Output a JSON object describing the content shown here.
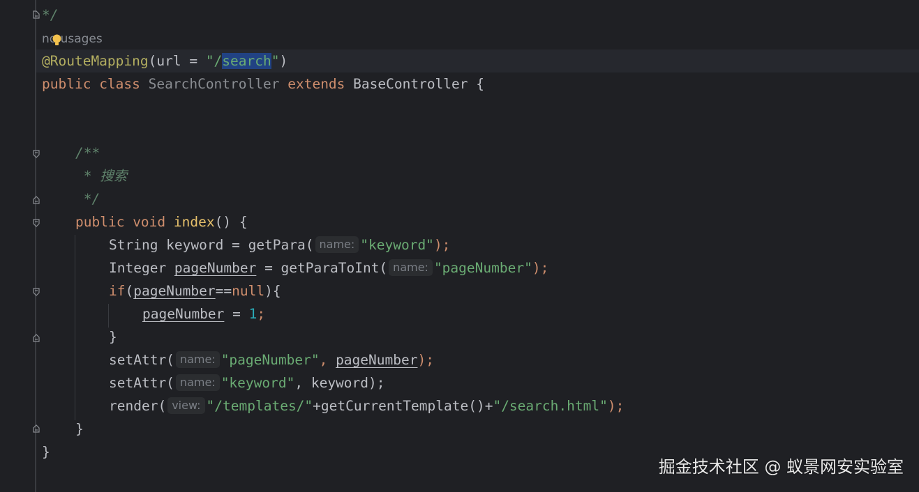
{
  "editor": {
    "usages_label": "no usages",
    "lines": {
      "l1": "*/",
      "l2_ann": "@RouteMapping",
      "l2_a": "(url = ",
      "l2_q1": "\"/",
      "l2_sel": "search",
      "l2_q2": "\"",
      "l2_b": ")",
      "l3_kw1": "public ",
      "l3_kw2": "class ",
      "l3_name": "SearchController ",
      "l3_kw3": "extends ",
      "l3_base": "BaseController {",
      "l4": "/**",
      "l5": " * 搜索",
      "l6": " */",
      "l7_kw1": "public ",
      "l7_kw2": "void ",
      "l7_fn": "index",
      "l7_rest": "() {",
      "l8_a": "String keyword = getPara(",
      "l8_hint": "name:",
      "l8_str": "\"keyword\"",
      "l8_b": ");",
      "l9_a": "Integer ",
      "l9_var": "pageNumber",
      "l9_b": " = getParaToInt(",
      "l9_hint": "name:",
      "l9_str": "\"pageNumber\"",
      "l9_c": ");",
      "l10_kw": "if",
      "l10_a": "(",
      "l10_var": "pageNumber",
      "l10_op": "==",
      "l10_null": "null",
      "l10_b": "){",
      "l11_var": "pageNumber",
      "l11_a": " = ",
      "l11_num": "1",
      "l11_b": ";",
      "l12": "}",
      "l13_a": "setAttr(",
      "l13_hint": "name:",
      "l13_str": "\"pageNumber\"",
      "l13_b": ", ",
      "l13_var": "pageNumber",
      "l13_c": ");",
      "l14_a": "setAttr(",
      "l14_hint": "name:",
      "l14_str": "\"keyword\"",
      "l14_b": ", keyword);",
      "l15_a": "render(",
      "l15_hint": "view:",
      "l15_str1": "\"/templates/\"",
      "l15_b": "+getCurrentTemplate()+",
      "l15_str2": "\"/search.html\"",
      "l15_c": ");",
      "l16": "}",
      "l17": "}"
    }
  },
  "watermark": "掘金技术社区 @ 蚁景网安实验室",
  "colors": {
    "background": "#1f2024",
    "annotation": "#b3ae60",
    "keyword": "#cf8e6d",
    "string": "#6aab73",
    "comment": "#5f826b",
    "selection": "#214283",
    "number": "#2aacb8"
  }
}
